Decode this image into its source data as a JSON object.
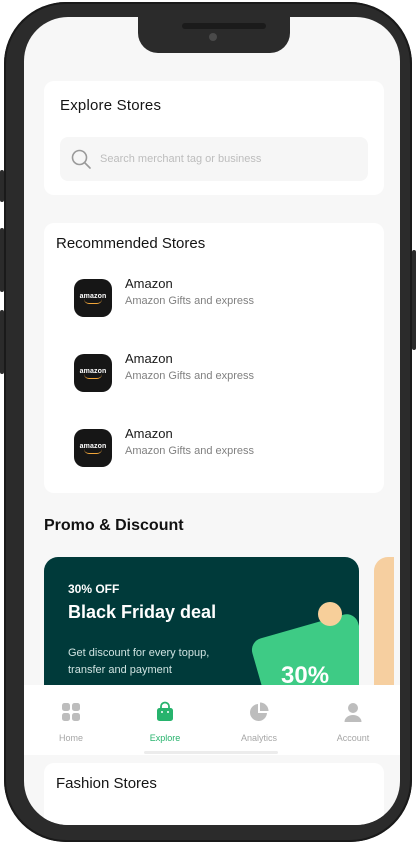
{
  "explore": {
    "title": "Explore  Stores",
    "search_placeholder": "Search merchant tag or business"
  },
  "recommended": {
    "title": "Recommended  Stores",
    "stores": [
      {
        "logo_text": "amazon",
        "name": "Amazon",
        "desc": "Amazon Gifts and express"
      },
      {
        "logo_text": "amazon",
        "name": "Amazon",
        "desc": "Amazon Gifts and express"
      },
      {
        "logo_text": "amazon",
        "name": "Amazon",
        "desc": "Amazon Gifts and express"
      }
    ]
  },
  "promo": {
    "title": "Promo & Discount",
    "card": {
      "off_label": "30% OFF",
      "deal_title": "Black Friday deal",
      "description": "Get discount for every topup, transfer and payment",
      "tag_text": "30%"
    }
  },
  "tabs": [
    {
      "label": "Home",
      "icon": "grid-icon",
      "active": false
    },
    {
      "label": "Explore",
      "icon": "shopping-bag-icon",
      "active": true
    },
    {
      "label": "Analytics",
      "icon": "pie-chart-icon",
      "active": false
    },
    {
      "label": "Account",
      "icon": "user-icon",
      "active": false
    }
  ],
  "fashion": {
    "title": "Fashion Stores"
  },
  "colors": {
    "accent_green": "#27b36d",
    "promo_bg": "#003a3a",
    "tag_green": "#3ecb85",
    "peach": "#f7cf9a"
  }
}
